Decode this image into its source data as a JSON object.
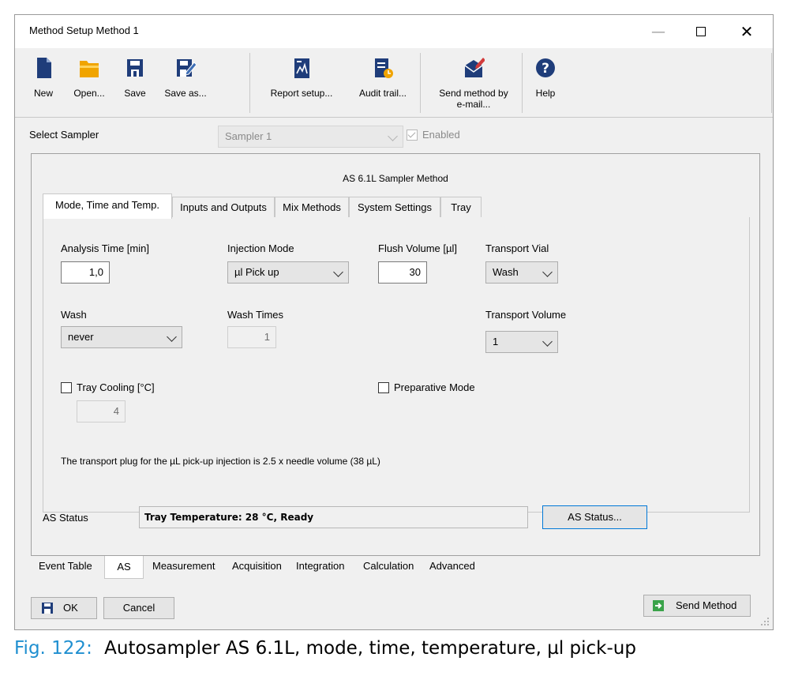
{
  "window": {
    "title": "Method Setup Method 1",
    "controls": {
      "minimize": "—",
      "close": "✕"
    }
  },
  "toolbar": {
    "items": [
      {
        "label": "New",
        "icon": "new-document-icon"
      },
      {
        "label": "Open...",
        "icon": "open-folder-icon"
      },
      {
        "label": "Save",
        "icon": "save-disk-icon"
      },
      {
        "label": "Save as...",
        "icon": "save-as-icon"
      },
      {
        "label": "Report setup...",
        "icon": "report-setup-icon"
      },
      {
        "label": "Audit trail...",
        "icon": "audit-trail-icon"
      },
      {
        "label": "Send method by e-mail...",
        "icon": "email-method-icon"
      },
      {
        "label": "Help",
        "icon": "help-icon"
      }
    ]
  },
  "sampler": {
    "label": "Select Sampler",
    "value": "Sampler 1",
    "enabled_label": "Enabled",
    "enabled": true
  },
  "panel": {
    "title": "AS 6.1L Sampler Method",
    "tabs": [
      "Mode, Time and Temp.",
      "Inputs and Outputs",
      "Mix Methods",
      "System Settings",
      "Tray"
    ],
    "active_tab": 0
  },
  "form": {
    "analysis_time": {
      "label": "Analysis Time [min]",
      "value": "1,0"
    },
    "injection_mode": {
      "label": "Injection Mode",
      "value": "µl Pick up"
    },
    "flush_volume": {
      "label": "Flush Volume [µl]",
      "value": "30"
    },
    "transport_vial": {
      "label": "Transport Vial",
      "value": "Wash"
    },
    "wash": {
      "label": "Wash",
      "value": "never"
    },
    "wash_times": {
      "label": "Wash Times",
      "value": "1"
    },
    "transport_volume": {
      "label": "Transport Volume",
      "value": "1"
    },
    "tray_cooling": {
      "label": "Tray Cooling [°C]",
      "value": "4",
      "checked": false
    },
    "preparative_mode": {
      "label": "Preparative Mode",
      "checked": false
    },
    "note": "The transport plug for the µL pick-up injection is 2.5 x needle volume (38 µL)"
  },
  "status": {
    "label": "AS Status",
    "text": "Tray Temperature: 28 °C, Ready",
    "button": "AS Status..."
  },
  "bottom_tabs": [
    "Event Table",
    "AS",
    "Measurement",
    "Acquisition",
    "Integration",
    "Calculation",
    "Advanced"
  ],
  "bottom_active_tab": 1,
  "footer": {
    "ok": "OK",
    "cancel": "Cancel",
    "send": "Send Method"
  },
  "caption": {
    "number": "Fig. 122:",
    "text": "Autosampler AS 6.1L, mode, time, temperature, µl pick-up"
  },
  "colors": {
    "accent": "#0078d7",
    "caption_blue": "#1f8fd0",
    "icon_navy": "#1f3d7a",
    "icon_orange": "#f0a400",
    "icon_green": "#3aa34a"
  }
}
